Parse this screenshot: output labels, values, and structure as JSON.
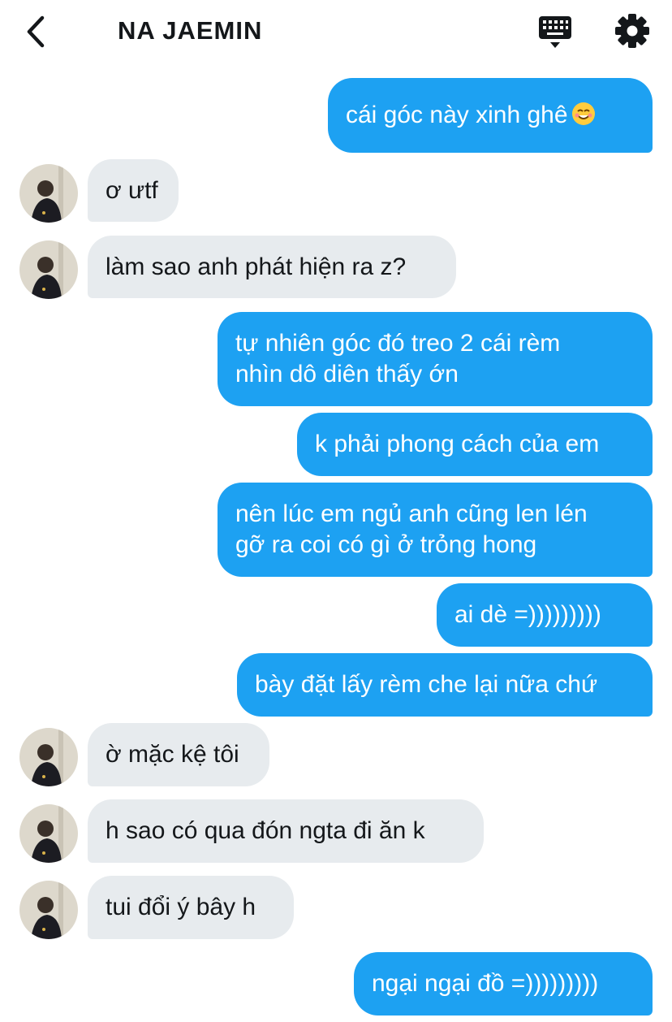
{
  "header": {
    "title": "NA JAEMIN",
    "back_icon": "chevron-left-icon",
    "keyboard_icon": "keyboard-icon",
    "settings_icon": "gear-icon"
  },
  "colors": {
    "outgoing_bubble": "#1da1f2",
    "incoming_bubble": "#e7ebee",
    "header_text": "#14171a"
  },
  "messages": [
    {
      "dir": "out",
      "lines": [
        "cái góc này xinh ghê"
      ],
      "emoji": "smiling-face-icon"
    },
    {
      "dir": "in",
      "lines": [
        "ơ ưtf"
      ]
    },
    {
      "dir": "in",
      "lines": [
        "làm sao anh phát hiện ra z?"
      ]
    },
    {
      "dir": "out",
      "lines": [
        "tự nhiên góc đó treo 2 cái rèm",
        "nhìn dô diên thấy ớn"
      ]
    },
    {
      "dir": "out",
      "lines": [
        "k phải phong cách của em"
      ]
    },
    {
      "dir": "out",
      "lines": [
        "nên lúc em ngủ anh cũng len lén",
        "gỡ ra coi có gì ở trỏng hong"
      ]
    },
    {
      "dir": "out",
      "lines": [
        "ai dè =)))))))))"
      ]
    },
    {
      "dir": "out",
      "lines": [
        "bày đặt lấy rèm che lại nữa chứ"
      ]
    },
    {
      "dir": "in",
      "lines": [
        "ờ mặc kệ tôi"
      ]
    },
    {
      "dir": "in",
      "lines": [
        "h sao có qua đón ngta đi ăn k"
      ]
    },
    {
      "dir": "in",
      "lines": [
        "tui đổi ý bây h"
      ]
    },
    {
      "dir": "out",
      "lines": [
        "ngại ngại đồ =)))))))))"
      ]
    }
  ]
}
